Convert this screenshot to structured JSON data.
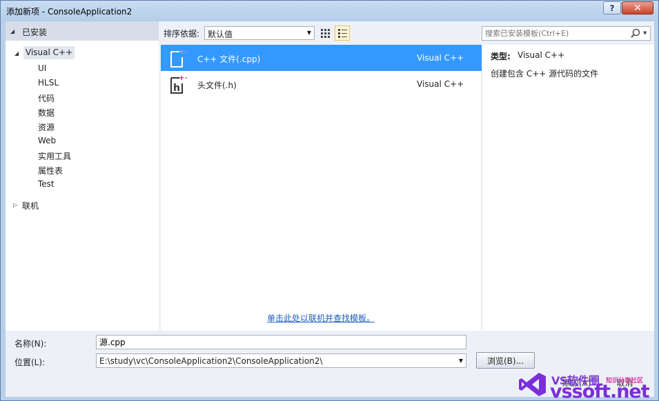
{
  "window": {
    "title": "添加新项 - ConsoleApplication2",
    "help_glyph": "?",
    "close_glyph": "✕"
  },
  "left_panel": {
    "installed_label": "已安装",
    "tree_root": "Visual C++",
    "children": [
      "UI",
      "HLSL",
      "代码",
      "数据",
      "资源",
      "Web",
      "实用工具",
      "属性表",
      "Test"
    ],
    "online_label": "联机"
  },
  "sort": {
    "label": "排序依据:",
    "value": "默认值"
  },
  "items": [
    {
      "name": "C++ 文件(.cpp)",
      "lang": "Visual C++",
      "icon": "cpp-file-icon",
      "selected": true
    },
    {
      "name": "头文件(.h)",
      "lang": "Visual C++",
      "icon": "header-file-icon",
      "selected": false
    }
  ],
  "online_link": "单击此处以联机并查找模板。",
  "search": {
    "placeholder": "搜索已安装模板(Ctrl+E)"
  },
  "details": {
    "type_label": "类型:",
    "type_value": "Visual C++",
    "description": "创建包含 C++ 源代码的文件"
  },
  "form": {
    "name_label": "名称(N):",
    "name_value": "源.cpp",
    "location_label": "位置(L):",
    "location_value": "E:\\study\\vc\\ConsoleApplication2\\ConsoleApplication2\\",
    "browse_label": "浏览(B)...",
    "add_label": "添加(A)",
    "cancel_label": "取消"
  },
  "watermark": {
    "top": "VS软件圈",
    "slogan": "知识分享社区",
    "domain": "vssoft.net"
  },
  "colors": {
    "selection": "#3399ff",
    "link": "#1a5bbf",
    "brand": "#7a2fd8"
  }
}
